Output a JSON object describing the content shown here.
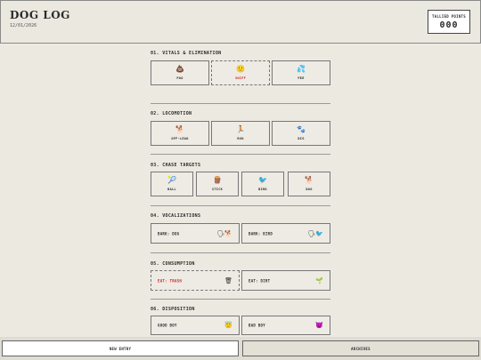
{
  "header": {
    "title": "DOG LOG",
    "date": "12/01/2026",
    "tally_label": "TALLIED POINTS",
    "tally_value": "000"
  },
  "sections": [
    {
      "title": "01. VITALS & ELIMINATION",
      "items": [
        {
          "label": "POO",
          "icon": "💩"
        },
        {
          "label": "SNIFF",
          "icon": "🙂"
        },
        {
          "label": "PEE",
          "icon": "💦"
        }
      ]
    },
    {
      "title": "02. LOCOMOTION",
      "items": [
        {
          "label": "OFF-LEAD",
          "icon": "🐕"
        },
        {
          "label": "RUN",
          "icon": "🏃"
        },
        {
          "label": "DIG",
          "icon": "🐾"
        }
      ]
    },
    {
      "title": "03. CHASE TARGETS",
      "items": [
        {
          "label": "BALL",
          "icon": "🎾"
        },
        {
          "label": "STICK",
          "icon": "🪵"
        },
        {
          "label": "BIRD",
          "icon": "🐦"
        },
        {
          "label": "DOG",
          "icon": "🐕"
        }
      ]
    },
    {
      "title": "04. VOCALIZATIONS",
      "items": [
        {
          "label": "BARK: DOG",
          "icon": "🗣🐕"
        },
        {
          "label": "BARK: BIRD",
          "icon": "🗣🐦"
        }
      ]
    },
    {
      "title": "05. CONSUMPTION",
      "items": [
        {
          "label": "EAT: TRASH",
          "icon": "🗑"
        },
        {
          "label": "EAT: DIRT",
          "icon": "🌱"
        }
      ]
    },
    {
      "title": "06. DISPOSITION",
      "items": [
        {
          "label": "GOOD BOY",
          "icon": "😇"
        },
        {
          "label": "BAD BOY",
          "icon": "😈"
        }
      ]
    }
  ],
  "footer": {
    "new_entry": "NEW ENTRY",
    "archives": "ARCHIVES"
  }
}
